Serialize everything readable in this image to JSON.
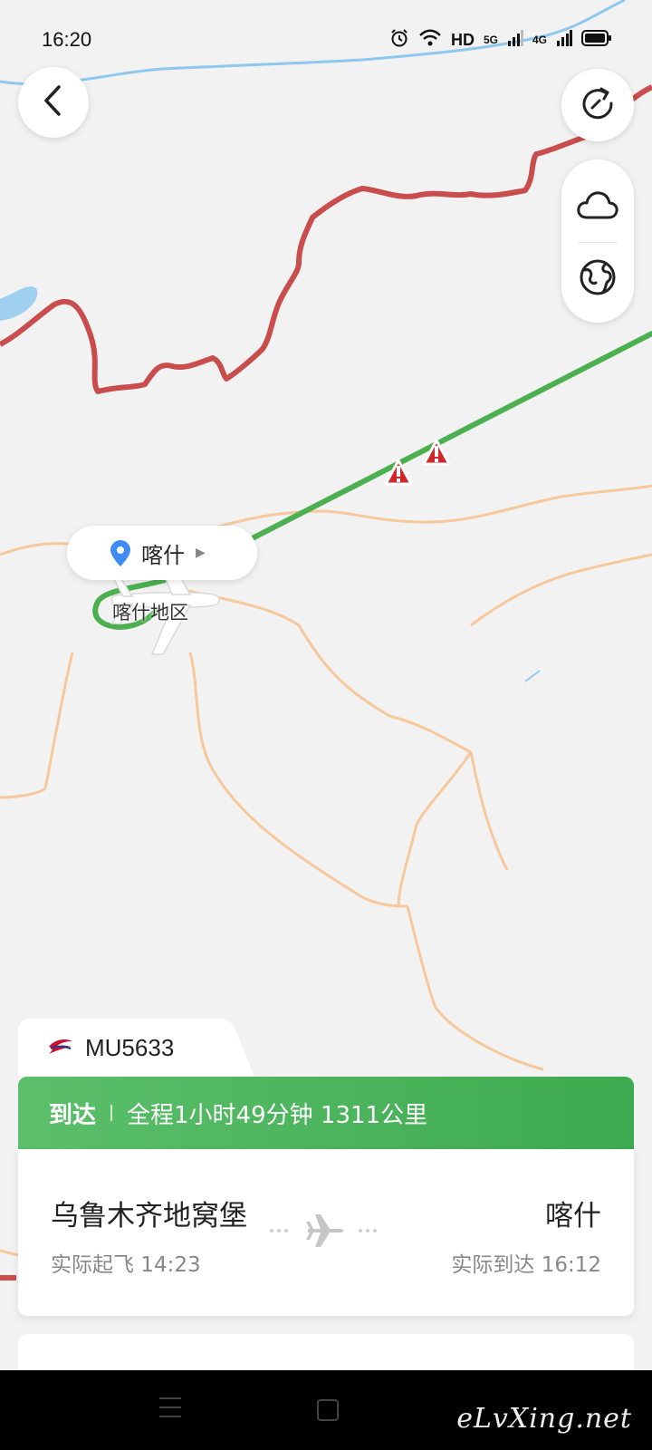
{
  "status_bar": {
    "time": "16:20",
    "network_label": "HD",
    "sim1_label": "5G",
    "sim2_label": "4G"
  },
  "map": {
    "location_chip": {
      "label": "喀什"
    },
    "place_label": "喀什地区",
    "route_color": "#4cb050",
    "border_color": "#c94d4d",
    "road_color": "#f6c89c",
    "warning_color": "#d0262c"
  },
  "flight": {
    "flight_no": "MU5633",
    "status": "到达",
    "summary": "全程1小时49分钟 1311公里",
    "departure": {
      "city": "乌鲁木齐地窝堡",
      "time": "实际起飞 14:23"
    },
    "arrival": {
      "city": "喀什",
      "time": "实际到达 16:12"
    }
  },
  "icons": {
    "back": "back-arrow-icon",
    "refresh": "refresh-icon",
    "weather": "cloud-icon",
    "globe": "globe-icon",
    "pin": "location-pin-icon",
    "plane": "airplane-icon",
    "airline": "airline-logo-icon"
  },
  "watermark": "eLvXing.net"
}
